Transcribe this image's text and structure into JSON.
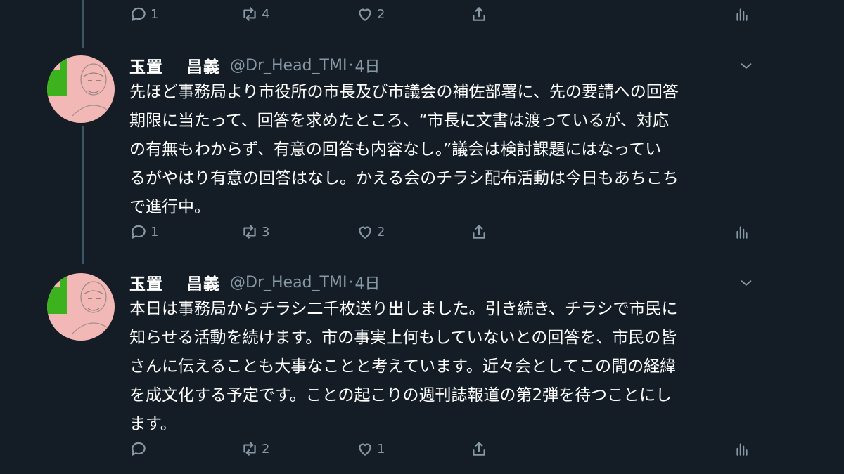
{
  "top_actions": {
    "reply_count": "1",
    "retweet_count": "4",
    "like_count": "2",
    "share_icon": "share-icon",
    "stats_icon": "analytics-icon"
  },
  "tweets": [
    {
      "display_name": "玉置　 昌義",
      "handle": "@Dr_Head_TMI",
      "separator": "·",
      "time": "4日",
      "text": "先ほど事務局より市役所の市長及び市議会の補佐部署に、先の要請への回答\n期限に当たって、回答を求めたところ、“市長に文書は渡っているが、対応\nの有無もわからず、有意の回答も内容なし。”議会は検討課題にはなってい\nるがやはり有意の回答はなし。かえる会のチラシ配布活動は今日もあちこち\nで進行中。",
      "reply_count": "1",
      "retweet_count": "3",
      "like_count": "2"
    },
    {
      "display_name": "玉置　 昌義",
      "handle": "@Dr_Head_TMI",
      "separator": "·",
      "time": "4日",
      "text": "本日は事務局からチラシ二千枚送り出しました。引き続き、チラシで市民に\n知らせる活動を続けます。市の事実上何もしていないとの回答を、市民の皆\nさんに伝えることも大事なことと考えています。近々会としてこの間の経緯\nを成文化する予定です。ことの起こりの週刊誌報道の第2弾を待つことにし\nます。",
      "reply_count": "",
      "retweet_count": "2",
      "like_count": "1"
    }
  ],
  "colors": {
    "background": "#141d26",
    "text": "#ffffff",
    "muted": "#8899a6",
    "thread_line": "#3d5466"
  }
}
